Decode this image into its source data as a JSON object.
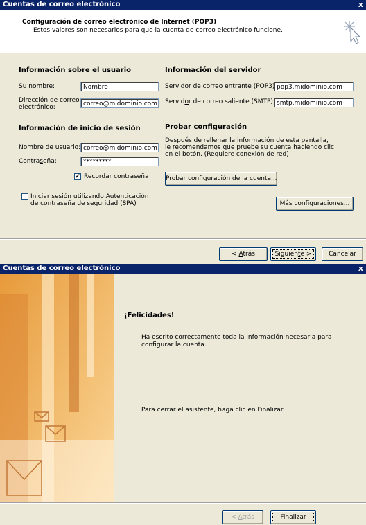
{
  "window1": {
    "title": "Cuentas de correo electrónico",
    "close_glyph": "x",
    "header": {
      "title": "Configuración de correo electrónico de Internet (POP3)",
      "subtitle": "Estos valores son necesarios para que la cuenta de correo electrónico funcione."
    },
    "user_info": {
      "heading": "Información sobre el usuario",
      "name_label_pre": "S",
      "name_label_ul": "u",
      "name_label_post": " nombre:",
      "name_value": "Nombre",
      "email_label_ul": "D",
      "email_label_line1": "irección de correo",
      "email_label_line2": "electrónico:",
      "email_value": "correo@midominio.com"
    },
    "server_info": {
      "heading": "Información del servidor",
      "incoming_label_ul": "S",
      "incoming_label_post": "ervidor de correo entrante (POP3):",
      "incoming_value": "pop3.midominio.com",
      "outgoing_label_pre": "Servid",
      "outgoing_label_ul": "o",
      "outgoing_label_post": "r de correo saliente (SMTP):",
      "outgoing_value": "smtp.midominio.com"
    },
    "login_info": {
      "heading": "Información de inicio de sesión",
      "user_label_pre": "No",
      "user_label_ul": "m",
      "user_label_post": "bre de usuario:",
      "user_value": "correo@midominio.com",
      "pass_label_pre": "Contra",
      "pass_label_ul": "s",
      "pass_label_post": "eña:",
      "pass_value": "*********",
      "remember_ul": "R",
      "remember_post": "ecordar contraseña",
      "spa_line1_ul": "I",
      "spa_line1_post": "niciar sesión utilizando Autenticación",
      "spa_line2": "de contraseña de seguridad (SPA)"
    },
    "test": {
      "heading": "Probar configuración",
      "line1": "Después de rellenar la información de esta pantalla,",
      "line2": "le recomendamos que pruebe su cuenta haciendo clic",
      "line3": "en el botón. (Requiere conexión de red)",
      "test_btn_ul": "P",
      "test_btn_post": "robar configuración de la cuenta...",
      "more_pre": "Más ",
      "more_ul": "c",
      "more_post": "onfiguraciones..."
    },
    "footer": {
      "back_pre": "< ",
      "back_ul": "A",
      "back_post": "trás",
      "next_pre": "Siguien",
      "next_ul": "t",
      "next_post": "e >",
      "cancel": "Cancelar"
    }
  },
  "window2": {
    "title": "Cuentas de correo electrónico",
    "close_glyph": "x",
    "heading": "¡Felicidades!",
    "line1": "Ha escrito correctamente toda la información necesaria para",
    "line2": "configurar la cuenta.",
    "line3": "Para cerrar el asistente, haga clic en Finalizar.",
    "footer": {
      "back_pre": "< ",
      "back_ul": "A",
      "back_post": "trás",
      "finish": "Finalizar"
    }
  },
  "colors": {
    "titlebar": "#0a246a",
    "dialog": "#ece9d8",
    "side_orange": "#f5b25c"
  },
  "icons": [
    "setup-wand-icon",
    "checkmark-icon",
    "envelope-icon"
  ]
}
